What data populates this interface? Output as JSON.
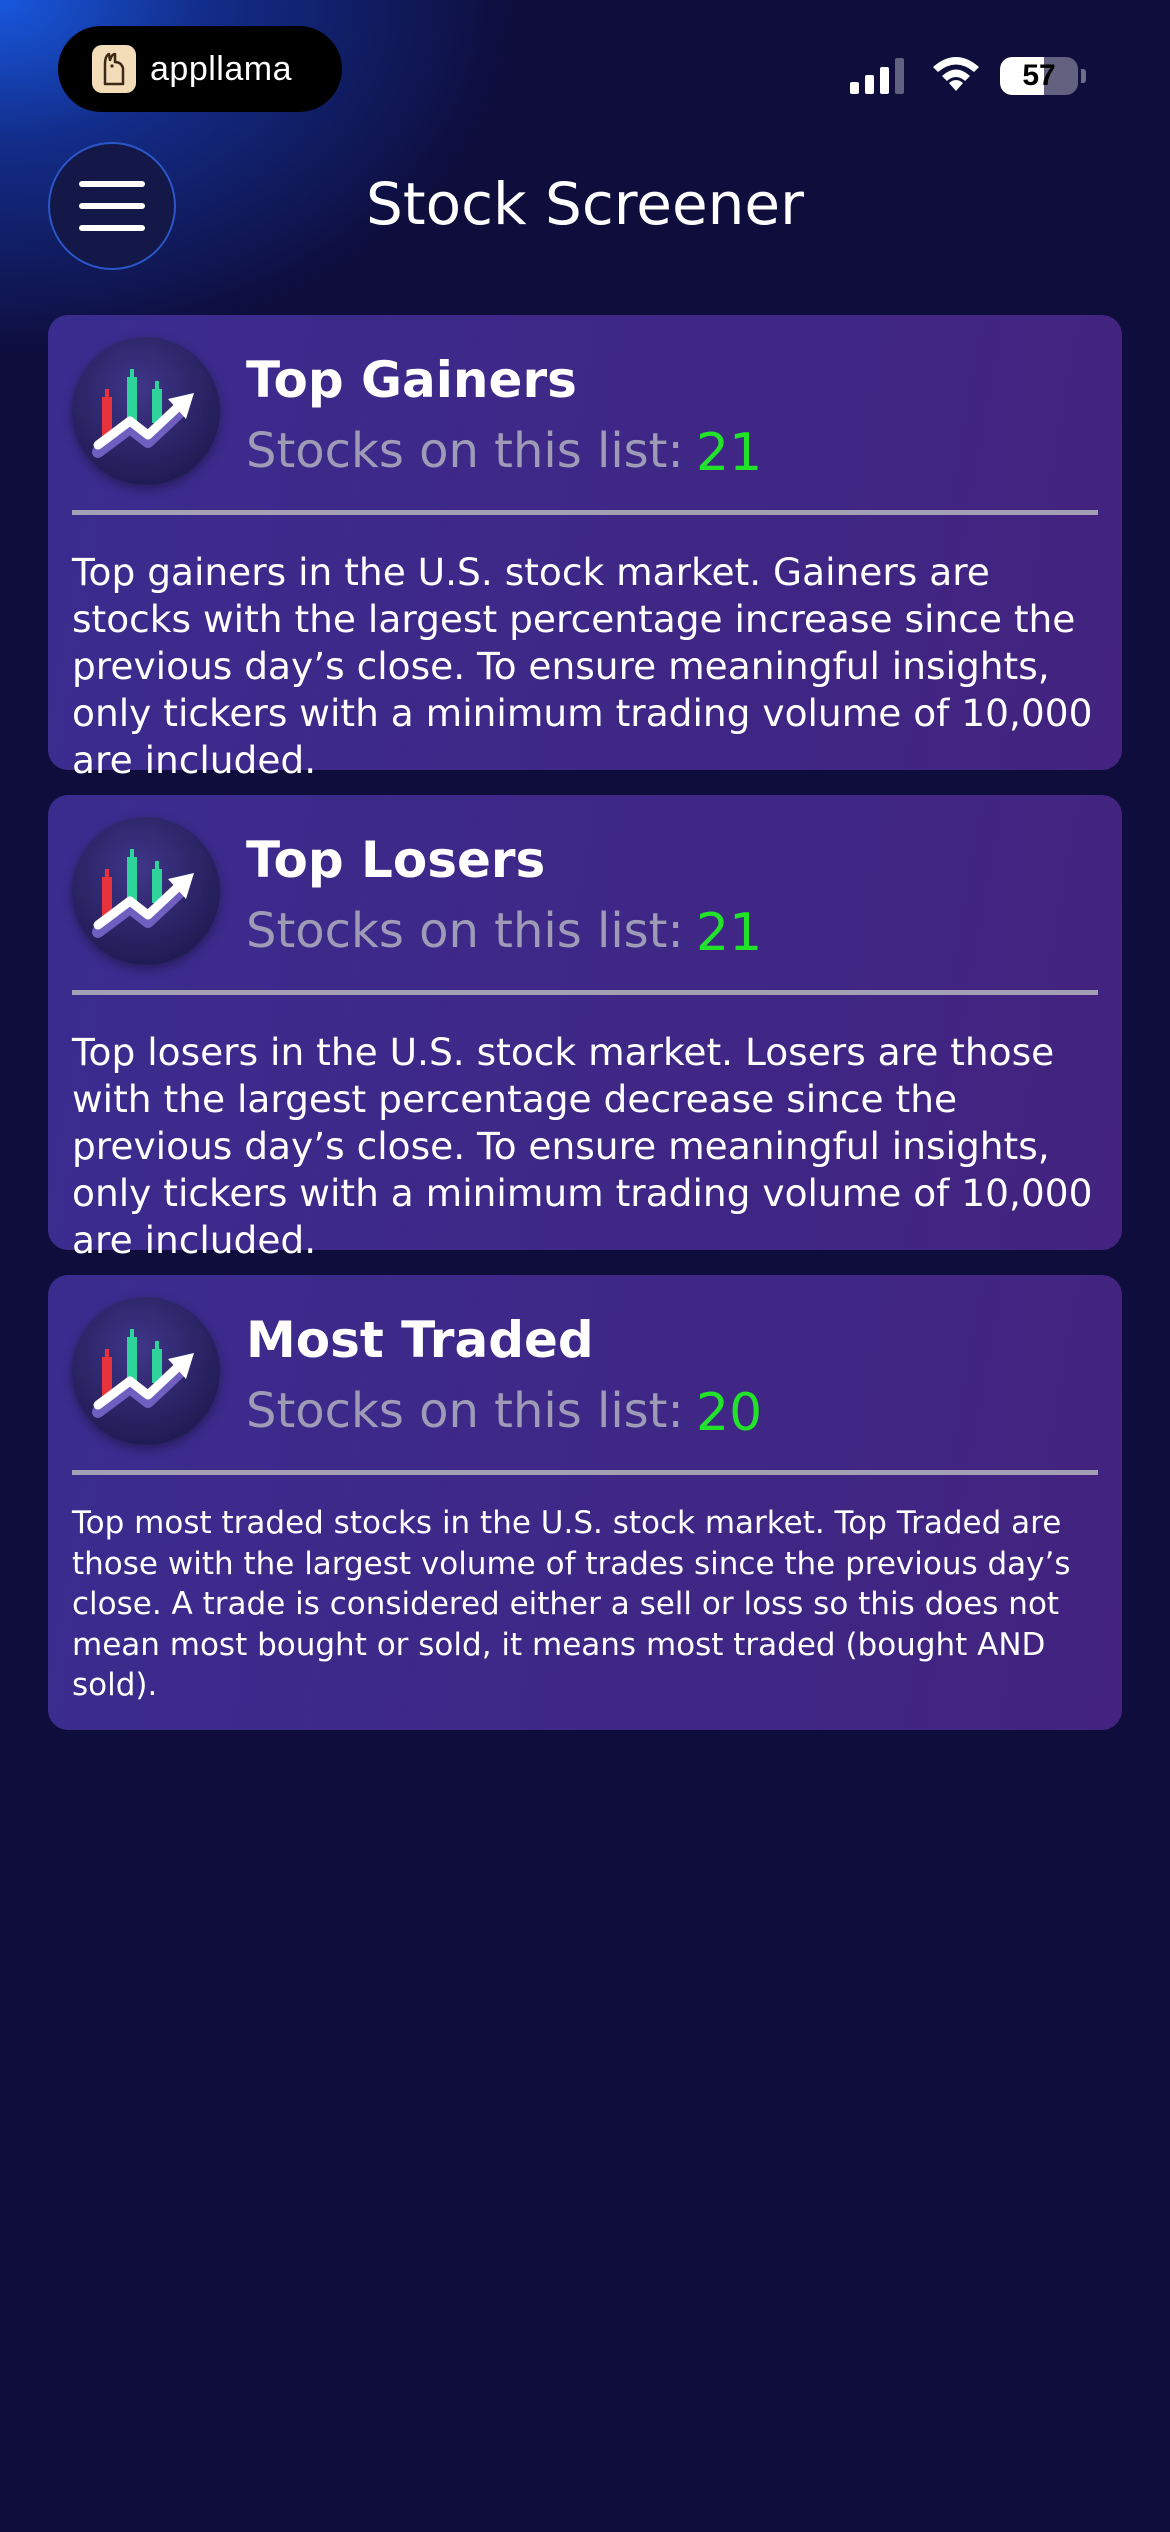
{
  "status_bar": {
    "app_badge": "appllama",
    "battery": "57"
  },
  "header": {
    "title": "Stock Screener"
  },
  "cards": [
    {
      "title": "Top Gainers",
      "count_label": "Stocks on this list:",
      "count": "21",
      "description": "Top gainers in the U.S. stock market. Gainers are stocks with the largest percentage increase since the previous day’s close. To ensure meaningful insights, only tickers with a minimum trading volume of 10,000 are included."
    },
    {
      "title": "Top Losers",
      "count_label": "Stocks on this list:",
      "count": "21",
      "description": "Top losers in the U.S. stock market. Losers are those with the largest percentage decrease since the previous day’s close. To ensure meaningful insights, only tickers with a minimum trading volume of 10,000 are included."
    },
    {
      "title": "Most Traded",
      "count_label": "Stocks on this list:",
      "count": "20",
      "description": "Top most traded stocks in the U.S. stock market. Top Traded are those with the largest volume of trades since the previous day’s close. A trade is considered either a sell or loss so this does not mean most bought or sold, it means most traded (bought AND sold)."
    }
  ],
  "colors": {
    "background": "#0e0d3b",
    "card": "#3a2c8f",
    "count_green": "#22e22a",
    "label_gray": "#9e9bb7"
  },
  "icons": {
    "menu": "hamburger-menu-icon",
    "card": "stock-chart-icon"
  }
}
